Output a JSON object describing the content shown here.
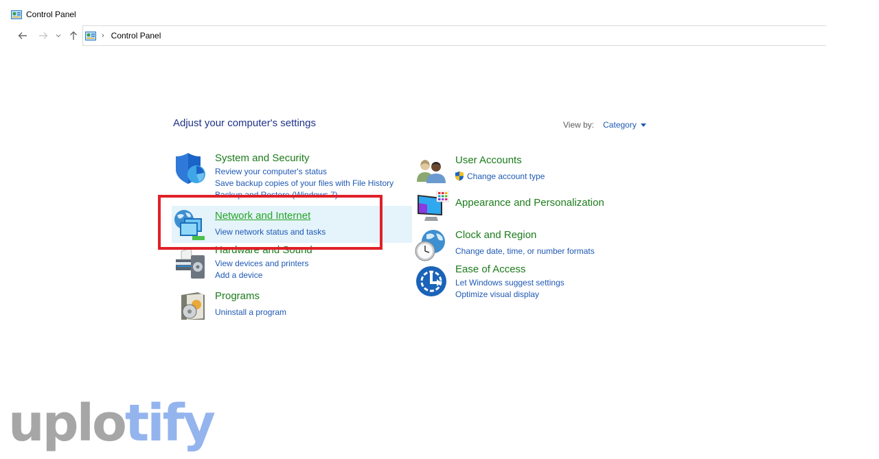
{
  "window": {
    "title": "Control Panel",
    "icon": "control-panel-icon"
  },
  "navigation": {
    "back_icon": "arrow-left-icon",
    "forward_icon": "arrow-right-icon",
    "recent_icon": "chevron-down-icon",
    "up_icon": "arrow-up-icon",
    "breadcrumb": [
      "Control Panel"
    ],
    "separator": "›"
  },
  "main": {
    "heading": "Adjust your computer's settings",
    "view_by": {
      "label": "View by:",
      "value": "Category"
    },
    "categories": [
      {
        "title": "System and Security",
        "icon": "shield-icon",
        "links": [
          "Review your computer's status",
          "Save backup copies of your files with File History",
          "Backup and Restore (Windows 7)"
        ]
      },
      {
        "title": "Network and Internet",
        "icon": "network-icon",
        "hovered": true,
        "links": [
          "View network status and tasks"
        ]
      },
      {
        "title": "Hardware and Sound",
        "icon": "printer-icon",
        "links": [
          "View devices and printers",
          "Add a device"
        ]
      },
      {
        "title": "Programs",
        "icon": "programs-icon",
        "links": [
          "Uninstall a program"
        ]
      },
      {
        "title": "User Accounts",
        "icon": "users-icon",
        "links": [
          "Change account type"
        ],
        "link_icon": "uac-shield-icon"
      },
      {
        "title": "Appearance and Personalization",
        "icon": "monitor-palette-icon",
        "links": []
      },
      {
        "title": "Clock and Region",
        "icon": "clock-globe-icon",
        "links": [
          "Change date, time, or number formats"
        ]
      },
      {
        "title": "Ease of Access",
        "icon": "ease-of-access-icon",
        "links": [
          "Let Windows suggest settings",
          "Optimize visual display"
        ]
      }
    ]
  },
  "annotation": {
    "highlight_color": "#e02028"
  },
  "watermark": {
    "part1": "uplo",
    "part2": "tify"
  },
  "colors": {
    "category_title": "#1b7b1b",
    "link": "#1e58b4",
    "heading": "#1e3287",
    "hover_bg": "#e5f3fb"
  }
}
